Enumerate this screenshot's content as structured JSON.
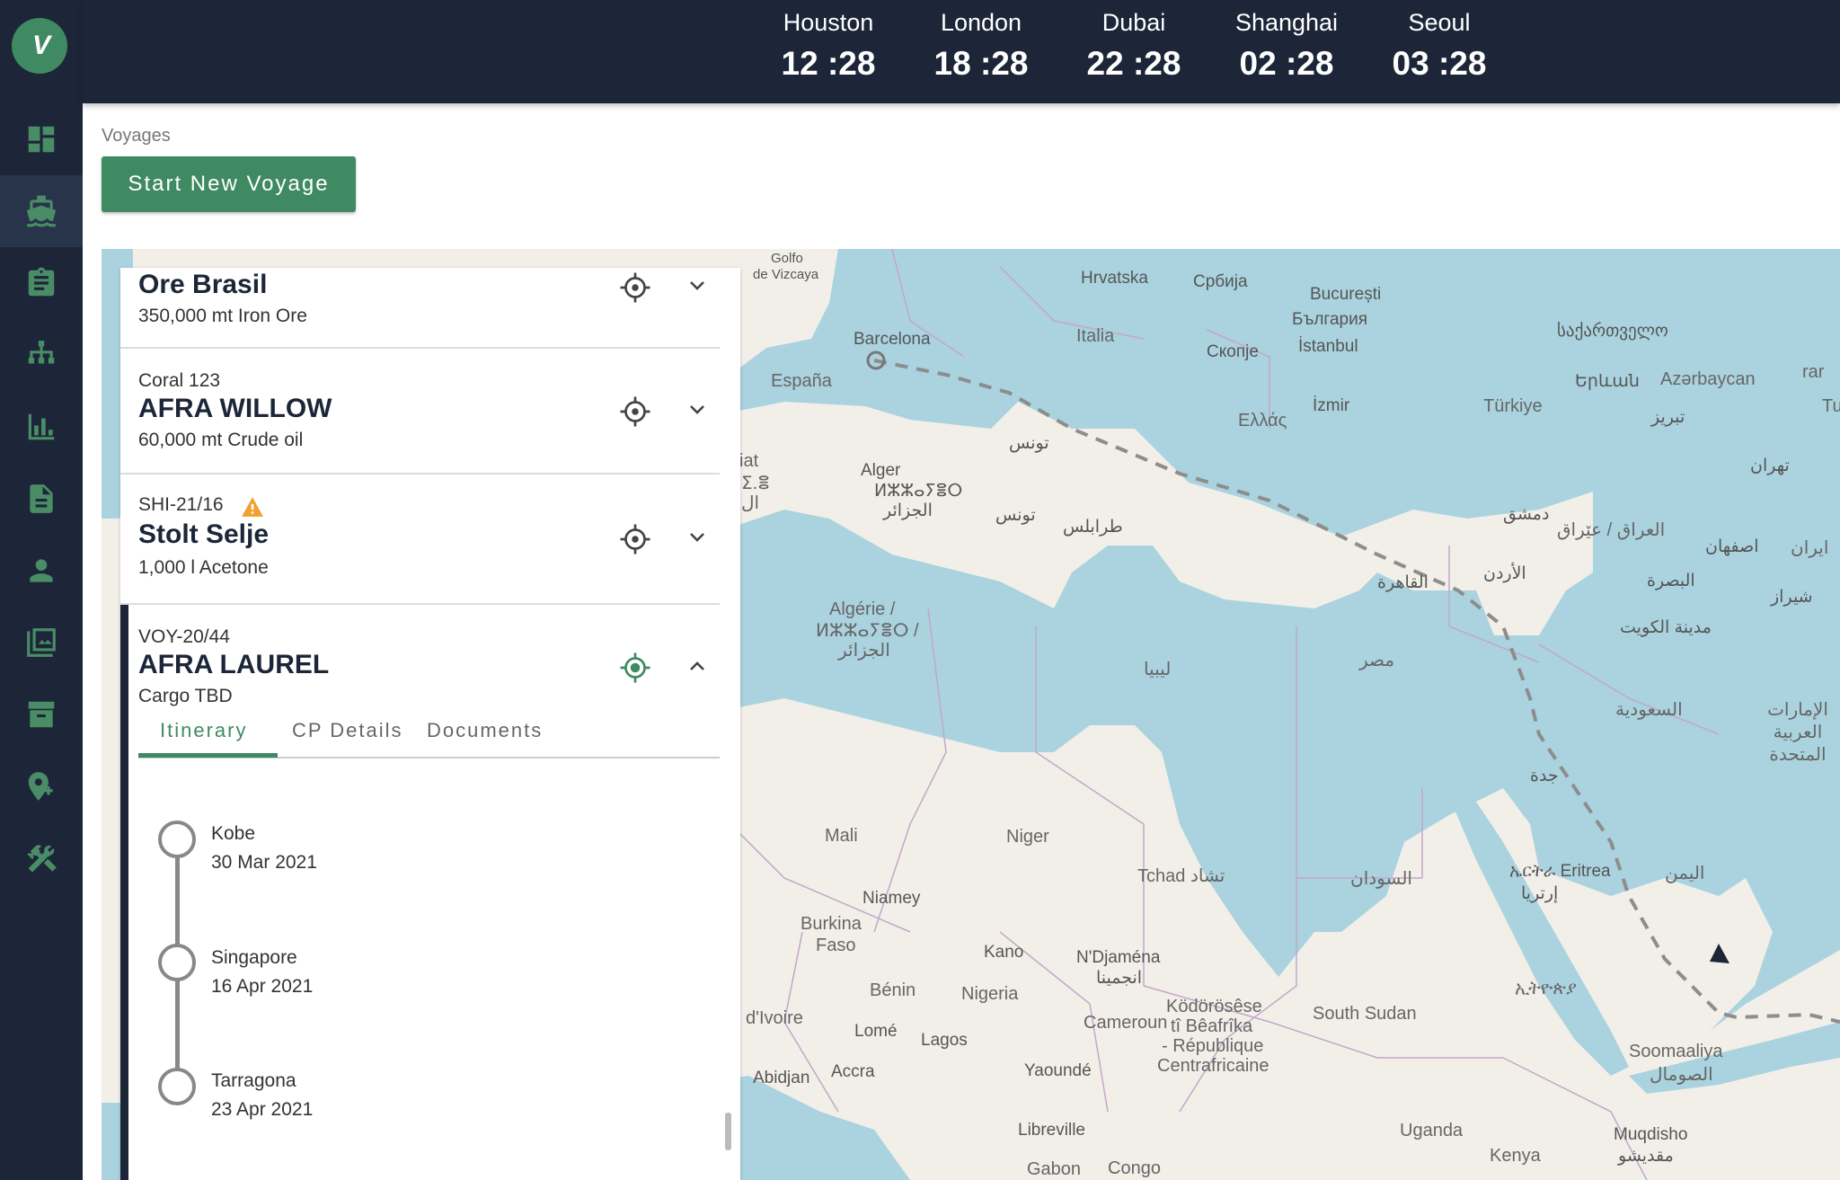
{
  "clocks": [
    {
      "city": "Houston",
      "time": "12 :28"
    },
    {
      "city": "London",
      "time": "18 :28"
    },
    {
      "city": "Dubai",
      "time": "22 :28"
    },
    {
      "city": "Shanghai",
      "time": "02 :28"
    },
    {
      "city": "Seoul",
      "time": "03 :28"
    }
  ],
  "breadcrumb": "Voyages",
  "start_button": "Start New Voyage",
  "voyages": [
    {
      "code": "",
      "name": "Ore Brasil",
      "cargo": "350,000 mt Iron Ore"
    },
    {
      "code": "Coral 123",
      "name": "AFRA WILLOW",
      "cargo": "60,000 mt Crude oil"
    },
    {
      "code": "SHI-21/16",
      "name": "Stolt Selje",
      "cargo": "1,000 l Acetone",
      "warning": true
    },
    {
      "code": "VOY-20/44",
      "name": "AFRA LAUREL",
      "cargo": "Cargo TBD",
      "expanded": true
    }
  ],
  "tabs": [
    "Itinerary",
    "CP Details",
    "Documents"
  ],
  "itinerary": [
    {
      "port": "Kobe",
      "date": "30 Mar 2021"
    },
    {
      "port": "Singapore",
      "date": "16 Apr 2021"
    },
    {
      "port": "Tarragona",
      "date": "23 Apr 2021"
    }
  ],
  "map_labels": {
    "golfo": "Golfo",
    "vizcaya": "de Vizcaya",
    "hrvatska": "Hrvatska",
    "srbija": "Србија",
    "bucuresti": "București",
    "bulgaria": "България",
    "georgia": "საქართველო",
    "barcelona": "Barcelona",
    "italia": "Italia",
    "skopje": "Скопје",
    "istanbul": "İstanbul",
    "yerevan": "Երևան",
    "azerbaycan": "Azərbaycan",
    "espana": "España",
    "tunis": "تونس",
    "ellas": "Ελλάς",
    "izmir": "İzmir",
    "turkiye": "Türkiye",
    "tabriz": "تبریز",
    "alger": "Alger",
    "alger_tif": "ⵍⵣⵣⴰⵢⴻⵔ",
    "aljazair": "الجزائر",
    "tunis2": "تونس",
    "tarabulus": "طرابلس",
    "dimashq": "دمشق",
    "iraq": "العراق / عێراق",
    "tehran": "تهران",
    "urdun": "الأردن",
    "qahira": "القاهرة",
    "isfahan": "اصفهان",
    "iran": "ایران",
    "basra": "البصرة",
    "algerie": "Algérie /",
    "algerie_tif": "ⵍⵣⵣⴰⵢⴻⵔ /",
    "algerie_ar": "الجزائر",
    "libya": "ليبيا",
    "misr": "مصر",
    "kuwait": "مدينة الكويت",
    "shiraz": "شیراز",
    "saudi": "السعودية",
    "uae": "الإمارات العربية المتحدة",
    "jeddah": "جدة",
    "mali": "Mali",
    "niger": "Niger",
    "tchad": "Tchad تشاد",
    "sudan": "السودان",
    "eritrea": "ኤርትራ Eritrea",
    "eritrea_ar": "إرتريا",
    "yemen": "اليمن",
    "niamey": "Niamey",
    "burkina": "Burkina",
    "faso": "Faso",
    "kano": "Kano",
    "ndjamena": "N'Djaména",
    "ndjamena_ar": "انجمينا",
    "ethiopia": "ኢትዮጵያ",
    "divoire": "d'Ivoire",
    "benin": "Bénin",
    "nigeria": "Nigeria",
    "kodorosese": "Ködörösêse",
    "beafrika": "tî Bêafrîka",
    "republique": "- République",
    "centrafricaine": "Centrafricaine",
    "cameroun": "Cameroun",
    "south_sudan": "South Sudan",
    "lome": "Lomé",
    "lagos": "Lagos",
    "abidjan": "Abidjan",
    "accra": "Accra",
    "yaounde": "Yaoundé",
    "somaaliya": "Soomaaliya",
    "somal_ar": "الصومال",
    "libreville": "Libreville",
    "gabon": "Gabon",
    "congo": "Congo",
    "uganda": "Uganda",
    "kenya": "Kenya",
    "muqdisho": "Muqdisho",
    "muqdisho_ar": "مقديشو",
    "rar": "rar",
    "tu": "Tu",
    "iat": "iat",
    "ie": "ⵉ.ⴻ",
    "al": "ال"
  },
  "colors": {
    "nav_bg": "#1c2638",
    "accent": "#3f8a63",
    "water": "#aad3df",
    "land": "#f2efe9"
  }
}
